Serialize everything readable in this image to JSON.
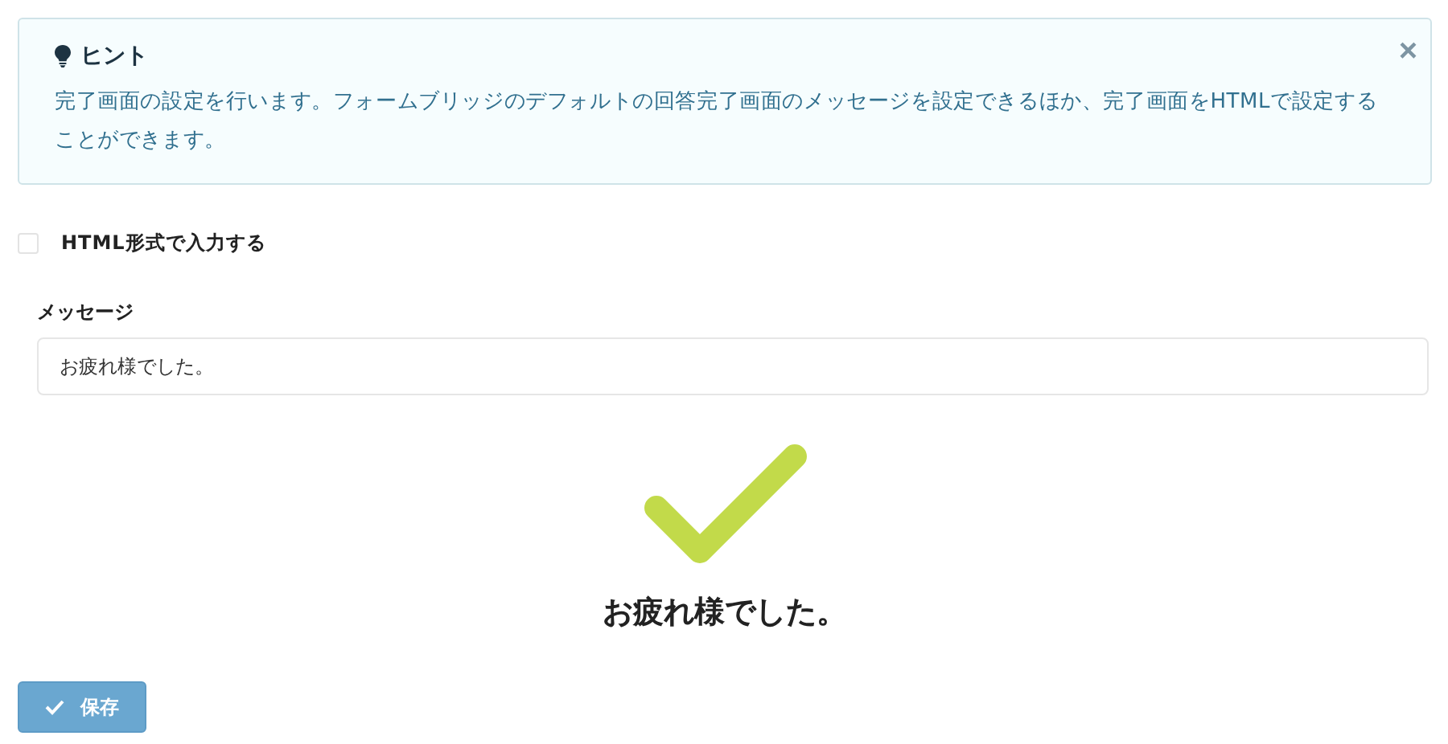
{
  "hint": {
    "title": "ヒント",
    "text": "完了画面の設定を行います。フォームブリッジのデフォルトの回答完了画面のメッセージを設定できるほか、完了画面をHTMLで設定することができます。",
    "close": "×"
  },
  "html_option": {
    "label": "HTML形式で入力する",
    "checked": false
  },
  "message_field": {
    "label": "メッセージ",
    "value": "お疲れ様でした。"
  },
  "preview": {
    "message": "お疲れ様でした。"
  },
  "save_button": {
    "label": "保存"
  }
}
